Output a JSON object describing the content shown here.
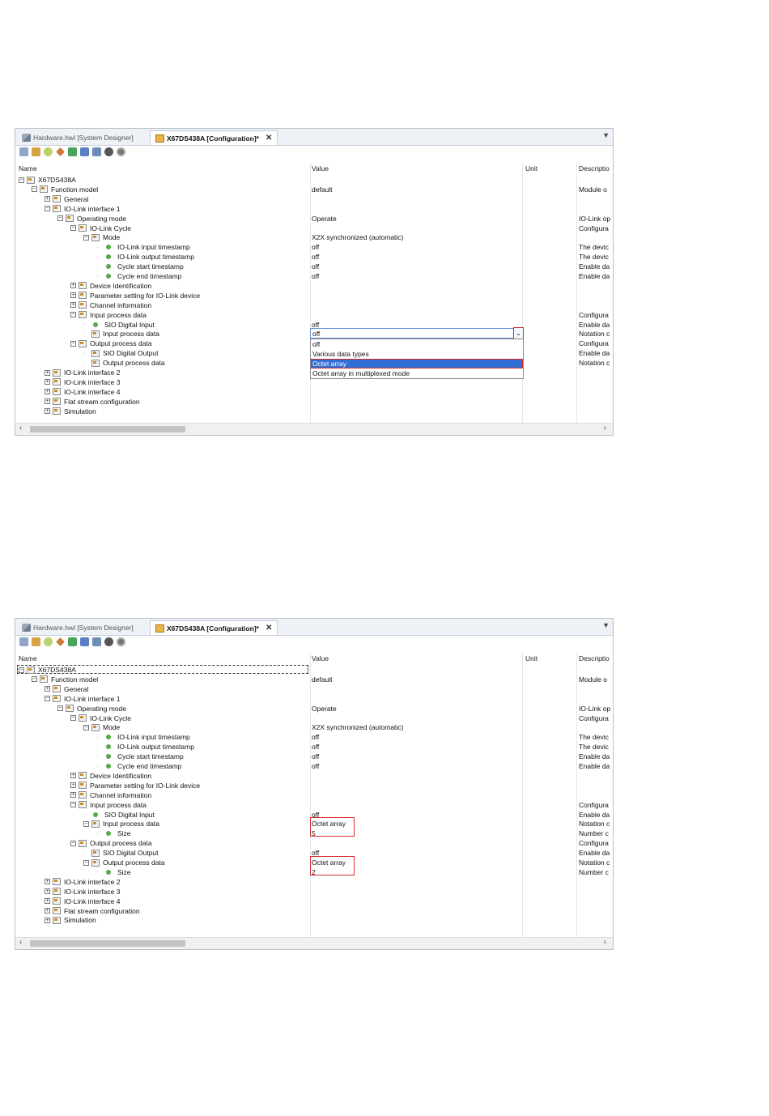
{
  "panels": [
    {
      "tabs": {
        "hardware": "Hardware.hwl [System Designer]",
        "config": "X67DS438A [Configuration]*"
      },
      "columns": {
        "name": "Name",
        "value": "Value",
        "unit": "Unit",
        "description": "Descriptio"
      },
      "rows": [
        {
          "label": "X67DS438A",
          "value": "",
          "desc": ""
        },
        {
          "label": "Function model",
          "value": "default",
          "desc": "Module o"
        },
        {
          "label": "General",
          "value": "",
          "desc": ""
        },
        {
          "label": "IO-Link interface 1",
          "value": "",
          "desc": ""
        },
        {
          "label": "Operating mode",
          "value": "Operate",
          "desc": "IO-Link op"
        },
        {
          "label": "IO-Link Cycle",
          "value": "",
          "desc": "Configura"
        },
        {
          "label": "Mode",
          "value": "X2X synchronized (automatic)",
          "desc": ""
        },
        {
          "label": "IO-Link input timestamp",
          "value": "off",
          "desc": "The devic"
        },
        {
          "label": "IO-Link output timestamp",
          "value": "off",
          "desc": "The devic"
        },
        {
          "label": "Cycle start timestamp",
          "value": "off",
          "desc": "Enable da"
        },
        {
          "label": "Cycle end timestamp",
          "value": "off",
          "desc": "Enable da"
        },
        {
          "label": "Device Identification",
          "value": "",
          "desc": ""
        },
        {
          "label": "Parameter setting for IO-Link device",
          "value": "",
          "desc": ""
        },
        {
          "label": "Channel information",
          "value": "",
          "desc": ""
        },
        {
          "label": "Input process data",
          "value": "",
          "desc": "Configura"
        },
        {
          "label": "SIO Digital Input",
          "value": "off",
          "desc": "Enable da"
        },
        {
          "label": "Input process data",
          "value": "off",
          "desc": "Notation c"
        },
        {
          "label": "Output process data",
          "value": "",
          "desc": "Configura"
        },
        {
          "label": "SIO Digital Output",
          "value": "",
          "desc": "Enable da"
        },
        {
          "label": "Output process data",
          "value": "",
          "desc": "Notation c"
        },
        {
          "label": "IO-Link interface 2",
          "value": "",
          "desc": ""
        },
        {
          "label": "IO-Link interface 3",
          "value": "",
          "desc": ""
        },
        {
          "label": "IO-Link interface 4",
          "value": "",
          "desc": ""
        },
        {
          "label": "Flat stream configuration",
          "value": "",
          "desc": ""
        },
        {
          "label": "Simulation",
          "value": "",
          "desc": ""
        }
      ],
      "dropdown_options": [
        "off",
        "Various data types",
        "Octet array",
        "Octet array in multiplexed mode"
      ]
    },
    {
      "tabs": {
        "hardware": "Hardware.hwl [System Designer]",
        "config": "X67DS438A [Configuration]*"
      },
      "columns": {
        "name": "Name",
        "value": "Value",
        "unit": "Unit",
        "description": "Descriptio"
      },
      "rows": [
        {
          "label": "X67DS438A",
          "value": "",
          "desc": ""
        },
        {
          "label": "Function model",
          "value": "default",
          "desc": "Module o"
        },
        {
          "label": "General",
          "value": "",
          "desc": ""
        },
        {
          "label": "IO-Link interface 1",
          "value": "",
          "desc": ""
        },
        {
          "label": "Operating mode",
          "value": "Operate",
          "desc": "IO-Link op"
        },
        {
          "label": "IO-Link Cycle",
          "value": "",
          "desc": "Configura"
        },
        {
          "label": "Mode",
          "value": "X2X synchronized (automatic)",
          "desc": ""
        },
        {
          "label": "IO-Link input timestamp",
          "value": "off",
          "desc": "The devic"
        },
        {
          "label": "IO-Link output timestamp",
          "value": "off",
          "desc": "The devic"
        },
        {
          "label": "Cycle start timestamp",
          "value": "off",
          "desc": "Enable da"
        },
        {
          "label": "Cycle end timestamp",
          "value": "off",
          "desc": "Enable da"
        },
        {
          "label": "Device Identification",
          "value": "",
          "desc": ""
        },
        {
          "label": "Parameter setting for IO-Link device",
          "value": "",
          "desc": ""
        },
        {
          "label": "Channel information",
          "value": "",
          "desc": ""
        },
        {
          "label": "Input process data",
          "value": "",
          "desc": "Configura"
        },
        {
          "label": "SIO Digital Input",
          "value": "off",
          "desc": "Enable da"
        },
        {
          "label": "Input process data",
          "value": "Octet array",
          "desc": "Notation c"
        },
        {
          "label": "Size",
          "value": "5",
          "desc": "Number c"
        },
        {
          "label": "Output process data",
          "value": "",
          "desc": "Configura"
        },
        {
          "label": "SIO Digital Output",
          "value": "off",
          "desc": "Enable da"
        },
        {
          "label": "Output process data",
          "value": "Octet array",
          "desc": "Notation c"
        },
        {
          "label": "Size",
          "value": "2",
          "desc": "Number c"
        },
        {
          "label": "IO-Link interface 2",
          "value": "",
          "desc": ""
        },
        {
          "label": "IO-Link interface 3",
          "value": "",
          "desc": ""
        },
        {
          "label": "IO-Link interface 4",
          "value": "",
          "desc": ""
        },
        {
          "label": "Flat stream configuration",
          "value": "",
          "desc": ""
        },
        {
          "label": "Simulation",
          "value": "",
          "desc": ""
        }
      ]
    }
  ]
}
